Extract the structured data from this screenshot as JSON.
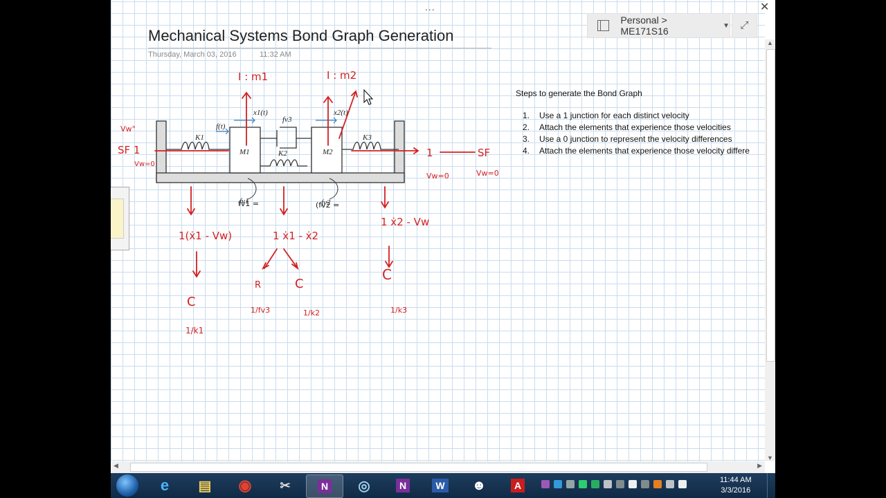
{
  "window": {
    "notebook_path": "Personal > ME171S16",
    "menu_dots": "...",
    "close_glyph": "✕",
    "expand_glyph": "⤢"
  },
  "page": {
    "title": "Mechanical Systems Bond Graph Generation",
    "date": "Thursday, March 03, 2016",
    "time": "11:32 AM"
  },
  "steps": {
    "heading": "Steps to generate the Bond Graph",
    "items": [
      {
        "num": "1.",
        "text": "Use a 1 junction for each distinct velocity"
      },
      {
        "num": "2.",
        "text": "Attach the elements that experience those velocities"
      },
      {
        "num": "3.",
        "text": "Use a 0 junction to represent the velocity differences"
      },
      {
        "num": "4.",
        "text": "Attach the elements that experience those velocity differe"
      }
    ]
  },
  "figure": {
    "labels": {
      "k1": "K1",
      "k3": "K3",
      "k2": "K2",
      "m1": "M1",
      "m2": "M2",
      "ft": "f(t)",
      "x1t": "x1(t)",
      "x2t": "x2(t)",
      "fv3": "fv3",
      "fv1": "fv1",
      "fv2": "fv2"
    },
    "ink": {
      "i_m1": "I : m1",
      "i_m2": "I : m2",
      "sf_left": "SF 1",
      "vw0_left": "Vw=0",
      "vw_top_left": "Vw°",
      "one_right": "1",
      "sf_right": "SF",
      "vw0_right1": "Vw=0",
      "vw0_right2": "Vw=0",
      "j1_label": "1(ẋ1 - Vw)",
      "j2_label": "1 ẋ1 - ẋ2",
      "j3_label": "1 ẋ2 - Vw",
      "c1": "C",
      "c1_val": "1/k1",
      "r": "R",
      "r_val": "1/fv3",
      "c2": "C",
      "c2_val": "1/k2",
      "c3": "C",
      "c3_val": "1/k3",
      "fv1_eq": "fv1 =",
      "fv2_eq": "(fv2 ="
    }
  },
  "taskbar": {
    "clock_time": "11:44 AM",
    "clock_date": "3/3/2016",
    "apps": [
      {
        "name": "internet-explorer",
        "glyph": "e"
      },
      {
        "name": "file-explorer",
        "glyph": "▤"
      },
      {
        "name": "chrome",
        "glyph": "◉"
      },
      {
        "name": "snipping-tool",
        "glyph": "✂"
      },
      {
        "name": "onenote",
        "glyph": "N"
      },
      {
        "name": "media-player",
        "glyph": "◎"
      },
      {
        "name": "onenote-2",
        "glyph": "N"
      },
      {
        "name": "word",
        "glyph": "W"
      },
      {
        "name": "owl-app",
        "glyph": "☻"
      },
      {
        "name": "acrobat",
        "glyph": "A"
      }
    ]
  }
}
